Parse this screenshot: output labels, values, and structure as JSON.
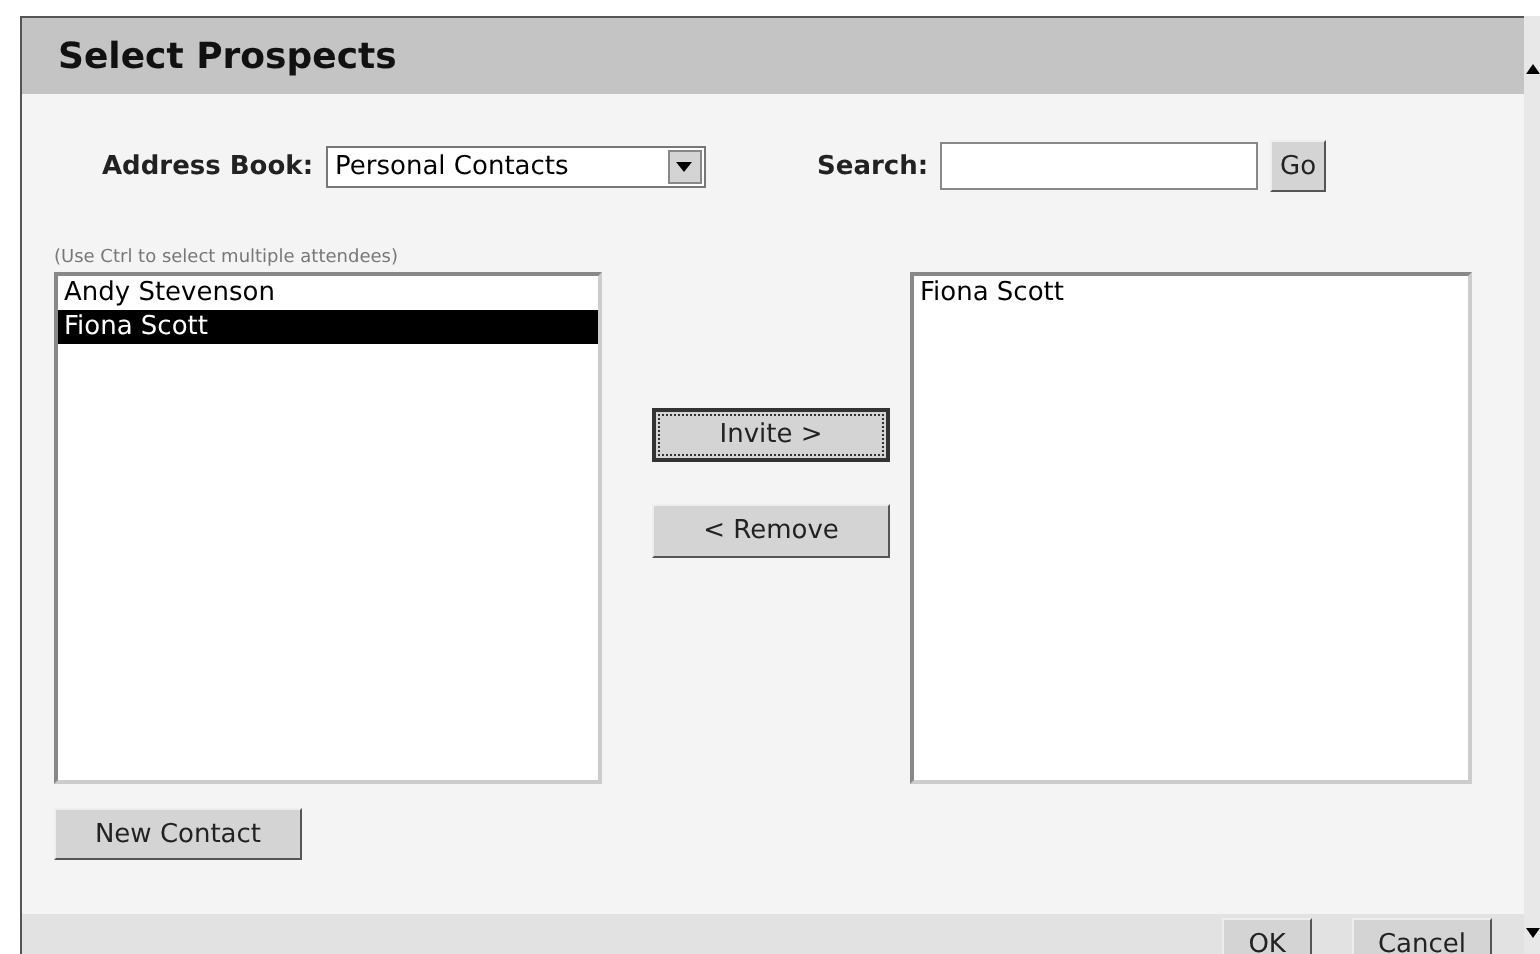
{
  "window": {
    "title": "Select Prospects"
  },
  "address_book": {
    "label": "Address Book:",
    "value": "Personal Contacts"
  },
  "search": {
    "label": "Search:",
    "button": "Go"
  },
  "hint": "(Use Ctrl to select multiple attendees)",
  "available": [
    {
      "name": "Andy Stevenson",
      "selected": false
    },
    {
      "name": "Fiona Scott",
      "selected": true
    }
  ],
  "move_buttons": [
    {
      "label": "Invite >",
      "focused": true
    },
    {
      "label": "< Remove",
      "focused": false
    }
  ],
  "invited": [
    {
      "name": "Fiona Scott",
      "selected": false
    }
  ],
  "new_contact_button": "New Contact",
  "footer_buttons": [
    "OK",
    "Cancel"
  ]
}
